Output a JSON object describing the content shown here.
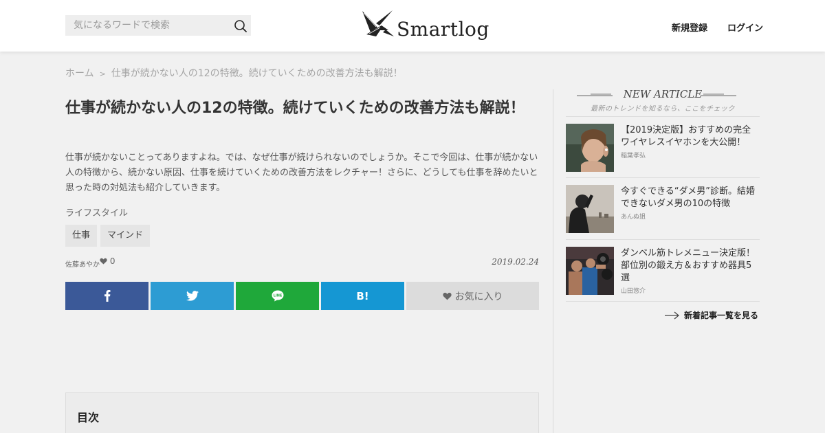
{
  "header": {
    "search_placeholder": "気になるワードで検索",
    "logo_text": "Smartlog",
    "register_label": "新規登録",
    "login_label": "ログイン"
  },
  "breadcrumb": {
    "home": "ホーム",
    "separator": ">",
    "current": "仕事が続かない人の12の特徴。続けていくための改善方法も解説！"
  },
  "article": {
    "title": "仕事が続かない人の12の特徴。続けていくための改善方法も解説！",
    "lead": "仕事が続かないことってありますよね。では、なぜ仕事が続けられないのでしょうか。そこで今回は、仕事が続かない人の特徴から、続かない原因、仕事を続けていくための改善方法をレクチャー！さらに、どうしても仕事を辞めたいと思った時の対処法も紹介していきます。",
    "category": "ライフスタイル",
    "tags": [
      "仕事",
      "マインド"
    ],
    "author": "佐藤あやか",
    "like_count": "0",
    "date": "2019.02.24",
    "favorite_label": "お気に入り"
  },
  "share": {
    "facebook_icon": "facebook-icon",
    "twitter_icon": "twitter-icon",
    "line_icon": "line-icon",
    "line_text": "LINE",
    "hatena_icon": "hatena-icon",
    "hatena_text": "B!"
  },
  "toc": {
    "title": "目次"
  },
  "sidebar": {
    "heading": "NEW ARTICLE",
    "subheading": "最新のトレンドを知るなら、ここをチェック",
    "items": [
      {
        "title": "【2019決定版】おすすめの完全ワイヤレスイヤホンを大公開！",
        "author": "稲葉孝弘"
      },
      {
        "title": "今すぐできる“ダメ男”診断。結婚できないダメ男の10の特徴",
        "author": "あんぬ姐"
      },
      {
        "title": "ダンベル筋トレメニュー決定版！部位別の鍛え方＆おすすめ器具5選",
        "author": "山田悠介"
      }
    ],
    "more_label": "新着記事一覧を見る"
  },
  "colors": {
    "facebook": "#3b5998",
    "twitter": "#2d9cd3",
    "line": "#1fa83a",
    "hatena": "#1597d3",
    "favorite_bg": "#dcdcdc"
  }
}
